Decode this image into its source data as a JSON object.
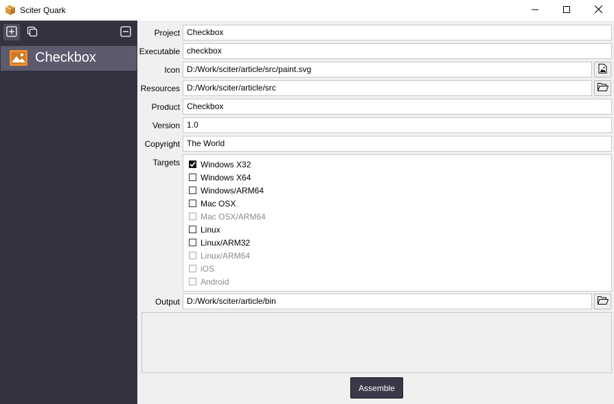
{
  "window": {
    "title": "Sciter Quark",
    "icon": "box-icon",
    "controls": [
      "minimize-icon",
      "maximize-icon",
      "close-icon"
    ]
  },
  "sidebar": {
    "toolbar": [
      "add-project-icon",
      "clone-project-icon",
      "remove-project-icon"
    ],
    "projects": [
      {
        "label": "Checkbox",
        "icon": "image-icon",
        "selected": true
      }
    ]
  },
  "form": {
    "project": {
      "label": "Project",
      "value": "Checkbox"
    },
    "executable": {
      "label": "Executable",
      "value": "checkbox"
    },
    "icon": {
      "label": "Icon",
      "value": "D:/Work/sciter/article/src/paint.svg",
      "button_icon": "image-file-icon"
    },
    "resources": {
      "label": "Resources",
      "value": "D:/Work/sciter/article/src",
      "button_icon": "folder-open-icon"
    },
    "product": {
      "label": "Product",
      "value": "Checkbox"
    },
    "version": {
      "label": "Version",
      "value": "1.0"
    },
    "copyright": {
      "label": "Copyright",
      "value": "The World"
    },
    "targets_label": "Targets",
    "targets": [
      {
        "label": "Windows X32",
        "checked": true,
        "enabled": true
      },
      {
        "label": "Windows X64",
        "checked": false,
        "enabled": true
      },
      {
        "label": "Windows/ARM64",
        "checked": false,
        "enabled": true
      },
      {
        "label": "Mac OSX",
        "checked": false,
        "enabled": true
      },
      {
        "label": "Mac OSX/ARM64",
        "checked": false,
        "enabled": false
      },
      {
        "label": "Linux",
        "checked": false,
        "enabled": true
      },
      {
        "label": "Linux/ARM32",
        "checked": false,
        "enabled": true
      },
      {
        "label": "Linux/ARM64",
        "checked": false,
        "enabled": false
      },
      {
        "label": "iOS",
        "checked": false,
        "enabled": false
      },
      {
        "label": "Android",
        "checked": false,
        "enabled": false
      }
    ],
    "output": {
      "label": "Output",
      "value": "D:/Work/sciter/article/bin",
      "button_icon": "folder-open-icon"
    },
    "assemble_label": "Assemble"
  },
  "colors": {
    "sidebar_bg": "#33323f",
    "selected_item_bg": "#5c5b6e",
    "accent_orange": "#f28c28",
    "button_dark": "#3a3948"
  }
}
